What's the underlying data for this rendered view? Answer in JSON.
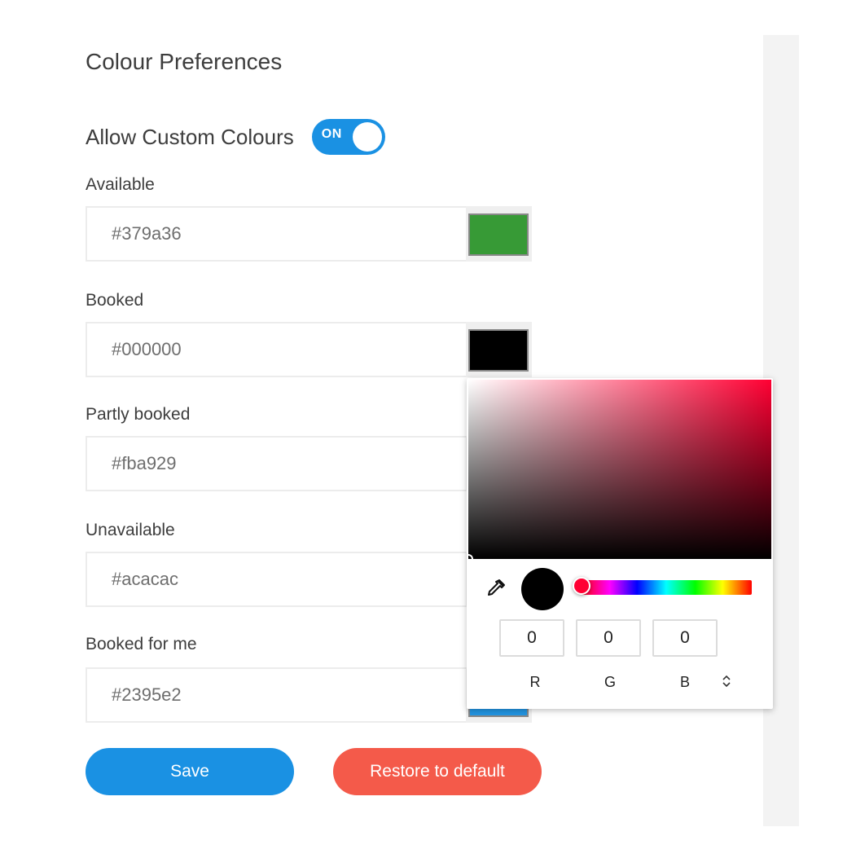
{
  "page": {
    "title": "Colour Preferences"
  },
  "toggle": {
    "label": "Allow Custom Colours",
    "state_text": "ON",
    "on": true
  },
  "fields": [
    {
      "label": "Available",
      "value": "#379a36",
      "swatch": "#379a36"
    },
    {
      "label": "Booked",
      "value": "#000000",
      "swatch": "#000000"
    },
    {
      "label": "Partly booked",
      "value": "#fba929",
      "swatch": "#fba929"
    },
    {
      "label": "Unavailable",
      "value": "#acacac",
      "swatch": "#acacac"
    },
    {
      "label": "Booked for me",
      "value": "#2395e2",
      "swatch": "#2395e2"
    }
  ],
  "buttons": {
    "save": "Save",
    "restore": "Restore to default"
  },
  "picker": {
    "hue_color": "#ff0033",
    "current_color": "#000000",
    "r": "0",
    "g": "0",
    "b": "0",
    "labels": {
      "r": "R",
      "g": "G",
      "b": "B"
    },
    "icons": {
      "eyedropper": "eyedropper-icon",
      "mode_toggle": "chevron-up-down-icon"
    }
  },
  "colors": {
    "accent": "#1a91e3",
    "danger": "#f45a4a",
    "sidebar": "#f3f3f3"
  }
}
